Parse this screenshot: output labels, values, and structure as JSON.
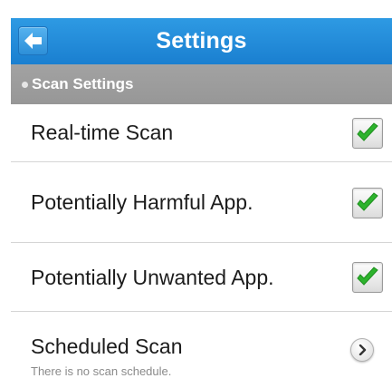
{
  "header": {
    "title": "Settings",
    "back_icon": "arrow-left-icon",
    "color": "#1f8ad8"
  },
  "section": {
    "title": "Scan Settings"
  },
  "settings": [
    {
      "label": "Real-time Scan",
      "control": "checkbox",
      "checked": true
    },
    {
      "label": "Potentially Harmful App.",
      "control": "checkbox",
      "checked": true
    },
    {
      "label": "Potentially Unwanted App.",
      "control": "checkbox",
      "checked": true
    },
    {
      "label": "Scheduled Scan",
      "sub": "There is no scan schedule.",
      "control": "chevron",
      "icon": "chevron-right-icon"
    }
  ],
  "check_color": "#2db32d"
}
